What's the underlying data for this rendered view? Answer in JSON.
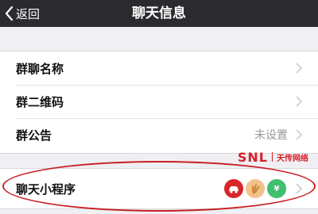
{
  "nav": {
    "back_label": "返回",
    "title": "聊天信息"
  },
  "group_a": {
    "rows": [
      {
        "label": "群聊名称",
        "value": ""
      },
      {
        "label": "群二维码",
        "value": ""
      },
      {
        "label": "群公告",
        "value": "未设置"
      }
    ]
  },
  "group_b": {
    "row": {
      "label": "聊天小程序",
      "apps": [
        {
          "icon": "red-car-app-icon",
          "text": "",
          "color": "#d9262b"
        },
        {
          "icon": "clapping-hands-app-icon",
          "text": "",
          "color": "#f2c28a"
        },
        {
          "icon": "green-coin-app-icon",
          "text": "¥",
          "color": "#3fbf6f"
        }
      ]
    }
  },
  "watermark": {
    "brand": "SNL",
    "cn": "天传网络"
  },
  "colors": {
    "navbar": "#2b2b2f",
    "background": "#efeff4",
    "highlight": "#c71d21"
  }
}
